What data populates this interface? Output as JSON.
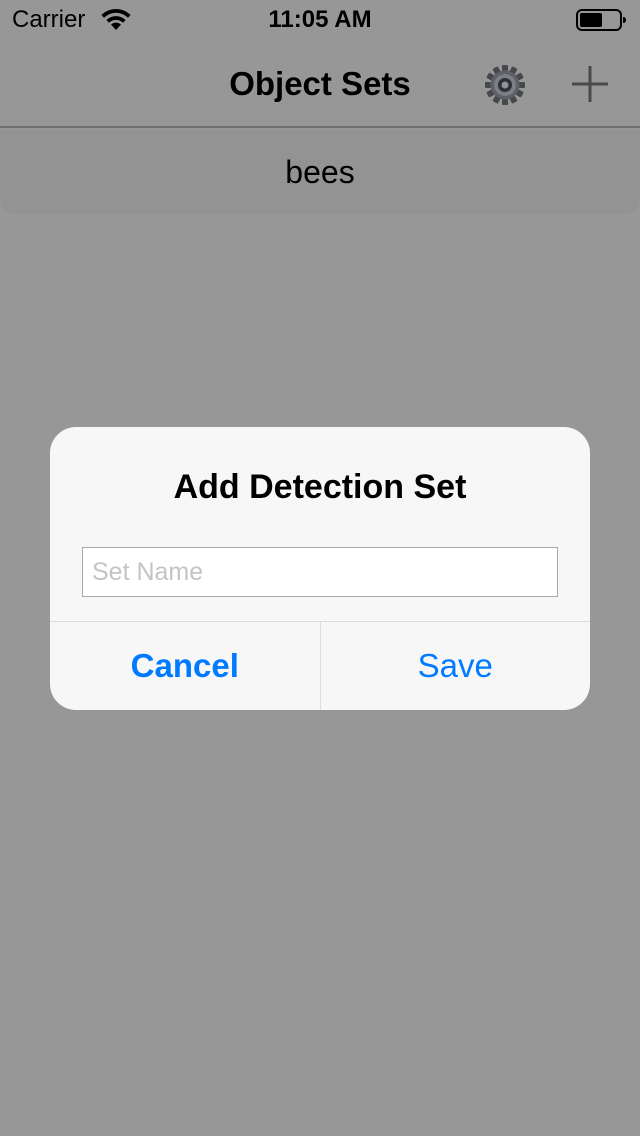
{
  "status_bar": {
    "carrier": "Carrier",
    "time": "11:05 AM"
  },
  "nav": {
    "title": "Object Sets",
    "settings_icon": "gear-icon",
    "add_icon": "plus-icon"
  },
  "list": {
    "items": [
      {
        "label": "bees"
      }
    ]
  },
  "alert": {
    "title": "Add Detection Set",
    "input_value": "",
    "input_placeholder": "Set Name",
    "cancel_label": "Cancel",
    "save_label": "Save"
  },
  "colors": {
    "dim_background": "#979797",
    "alert_background": "#f7f7f7",
    "accent": "#007aff"
  }
}
